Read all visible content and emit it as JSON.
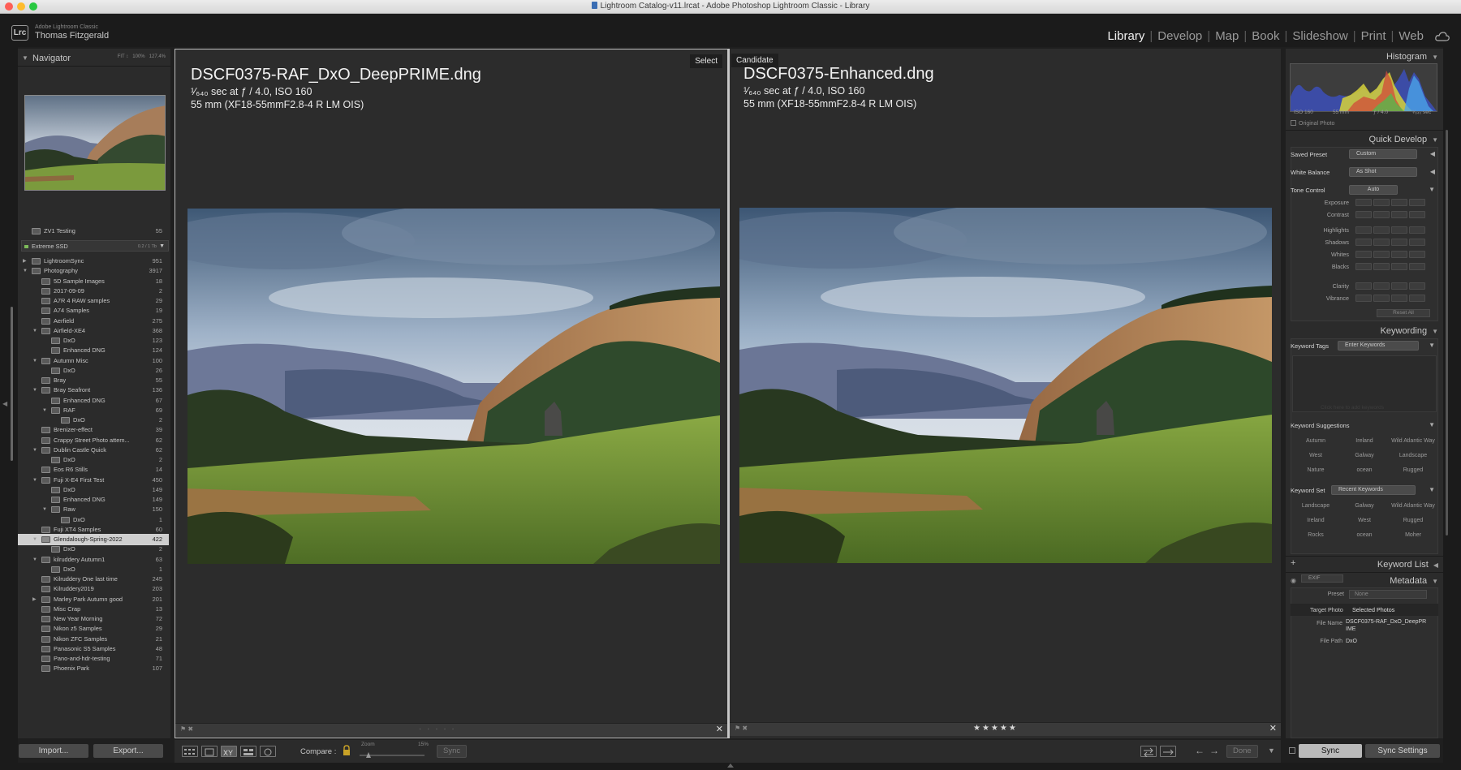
{
  "window": {
    "title": "Lightroom Catalog-v11.lrcat - Adobe Photoshop Lightroom Classic - Library"
  },
  "identity": {
    "logo": "Lrc",
    "app_name": "Adobe Lightroom Classic",
    "user_name": "Thomas Fitzgerald"
  },
  "modules": [
    "Library",
    "Develop",
    "Map",
    "Book",
    "Slideshow",
    "Print",
    "Web"
  ],
  "active_module": "Library",
  "navigator": {
    "title": "Navigator",
    "zooms": [
      "FIT ↕",
      "100%",
      "127.4%"
    ]
  },
  "folders": {
    "zvi": {
      "name": "ZV1 Testing",
      "count": "55"
    },
    "volume": {
      "name": "Extreme SSD",
      "size": "0.2 / 1 Tb"
    },
    "rows": [
      {
        "name": "LightroomSync",
        "count": "951",
        "depth": 0,
        "disc": "▶"
      },
      {
        "name": "Photography",
        "count": "3917",
        "depth": 0,
        "disc": "▼"
      },
      {
        "name": "5D Sample Images",
        "count": "18",
        "depth": 1,
        "disc": ""
      },
      {
        "name": "2017-09-09",
        "count": "2",
        "depth": 1,
        "disc": ""
      },
      {
        "name": "A7R 4 RAW samples",
        "count": "29",
        "depth": 1,
        "disc": ""
      },
      {
        "name": "A74 Samples",
        "count": "19",
        "depth": 1,
        "disc": ""
      },
      {
        "name": "Aerfield",
        "count": "275",
        "depth": 1,
        "disc": ""
      },
      {
        "name": "Airfield-XE4",
        "count": "368",
        "depth": 1,
        "disc": "▼"
      },
      {
        "name": "DxO",
        "count": "123",
        "depth": 2,
        "disc": ""
      },
      {
        "name": "Enhanced DNG",
        "count": "124",
        "depth": 2,
        "disc": ""
      },
      {
        "name": "Autumn Misc",
        "count": "100",
        "depth": 1,
        "disc": "▼"
      },
      {
        "name": "DxO",
        "count": "26",
        "depth": 2,
        "disc": ""
      },
      {
        "name": "Bray",
        "count": "55",
        "depth": 1,
        "disc": ""
      },
      {
        "name": "Bray Seafront",
        "count": "136",
        "depth": 1,
        "disc": "▼"
      },
      {
        "name": "Enhanced DNG",
        "count": "67",
        "depth": 2,
        "disc": ""
      },
      {
        "name": "RAF",
        "count": "69",
        "depth": 2,
        "disc": "▼"
      },
      {
        "name": "DxO",
        "count": "2",
        "depth": 3,
        "disc": ""
      },
      {
        "name": "Brenizer-effect",
        "count": "39",
        "depth": 1,
        "disc": ""
      },
      {
        "name": "Crappy Street Photo attem...",
        "count": "62",
        "depth": 1,
        "disc": ""
      },
      {
        "name": "Dublin Castle Quick",
        "count": "62",
        "depth": 1,
        "disc": "▼"
      },
      {
        "name": "DxO",
        "count": "2",
        "depth": 2,
        "disc": ""
      },
      {
        "name": "Eos R6 Stills",
        "count": "14",
        "depth": 1,
        "disc": ""
      },
      {
        "name": "Fuji X-E4 First Test",
        "count": "450",
        "depth": 1,
        "disc": "▼"
      },
      {
        "name": "DxO",
        "count": "149",
        "depth": 2,
        "disc": ""
      },
      {
        "name": "Enhanced DNG",
        "count": "149",
        "depth": 2,
        "disc": ""
      },
      {
        "name": "Raw",
        "count": "150",
        "depth": 2,
        "disc": "▼"
      },
      {
        "name": "DxO",
        "count": "1",
        "depth": 3,
        "disc": ""
      },
      {
        "name": "Fuji XT4 Samples",
        "count": "60",
        "depth": 1,
        "disc": ""
      },
      {
        "name": "Glendalough-Spring-2022",
        "count": "422",
        "depth": 1,
        "disc": "▼",
        "selected": true
      },
      {
        "name": "DxO",
        "count": "2",
        "depth": 2,
        "disc": ""
      },
      {
        "name": "kilruddery Autumn1",
        "count": "63",
        "depth": 1,
        "disc": "▼"
      },
      {
        "name": "DxO",
        "count": "1",
        "depth": 2,
        "disc": ""
      },
      {
        "name": "Kilruddery One last time",
        "count": "245",
        "depth": 1,
        "disc": ""
      },
      {
        "name": "Kilruddery2019",
        "count": "203",
        "depth": 1,
        "disc": ""
      },
      {
        "name": "Marley Park Autumn good",
        "count": "201",
        "depth": 1,
        "disc": "▶"
      },
      {
        "name": "Misc Crap",
        "count": "13",
        "depth": 1,
        "disc": ""
      },
      {
        "name": "New Year Morning",
        "count": "72",
        "depth": 1,
        "disc": ""
      },
      {
        "name": "Nikon z5 Samples",
        "count": "29",
        "depth": 1,
        "disc": ""
      },
      {
        "name": "Nikon ZFC Samples",
        "count": "21",
        "depth": 1,
        "disc": ""
      },
      {
        "name": "Panasonic S5 Samples",
        "count": "48",
        "depth": 1,
        "disc": ""
      },
      {
        "name": "Pano-and-hdr-testing",
        "count": "71",
        "depth": 1,
        "disc": ""
      },
      {
        "name": "Phoenix Park",
        "count": "107",
        "depth": 1,
        "disc": ""
      }
    ]
  },
  "left_buttons": {
    "import": "Import...",
    "export": "Export..."
  },
  "compare": {
    "select": {
      "tag": "Select",
      "filename": "DSCF0375-RAF_DxO_DeepPRIME.dng",
      "exif_shutter": "¹⁄₆₄₀ sec at ƒ / 4.0, ISO 160",
      "exif_lens": "55 mm (XF18-55mmF2.8-4 R LM OIS)",
      "stars": "· · · · ·"
    },
    "candidate": {
      "tag": "Candidate",
      "filename": "DSCF0375-Enhanced.dng",
      "exif_shutter": "¹⁄₆₄₀ sec at ƒ / 4.0, ISO 160",
      "exif_lens": "55 mm (XF18-55mmF2.8-4 R LM OIS)",
      "stars": "★★★★★"
    }
  },
  "toolbar": {
    "compare_label": "Compare :",
    "zoom_label": "Zoom",
    "zoom_value": "15%",
    "sync": "Sync",
    "done": "Done"
  },
  "right_panel": {
    "histogram": {
      "title": "Histogram",
      "iso": "ISO 160",
      "focal": "55 mm",
      "aperture": "ƒ / 4.0",
      "shutter": "¹⁄₆₄₀ sec",
      "original_photo": "Original Photo"
    },
    "quick_develop": {
      "title": "Quick Develop",
      "saved_preset_label": "Saved Preset",
      "saved_preset_value": "Custom",
      "wb_label": "White Balance",
      "wb_value": "As Shot",
      "tone_label": "Tone Control",
      "auto": "Auto",
      "rows": [
        "Exposure",
        "Contrast",
        "Highlights",
        "Shadows",
        "Whites",
        "Blacks",
        "Clarity",
        "Vibrance"
      ],
      "reset": "Reset All"
    },
    "keywording": {
      "title": "Keywording",
      "tags_label": "Keyword Tags",
      "tags_value": "Enter Keywords",
      "placeholder": "Click here to add keywords",
      "suggestions_label": "Keyword Suggestions",
      "suggestions": [
        "Autumn",
        "Ireland",
        "Wild Atlantic Way",
        "West",
        "Galway",
        "Landscape",
        "Nature",
        "ocean",
        "Rugged"
      ],
      "set_label": "Keyword Set",
      "set_value": "Recent Keywords",
      "set": [
        "Landscape",
        "Galway",
        "Wild Atlantic Way",
        "Ireland",
        "West",
        "Rugged",
        "Rocks",
        "ocean",
        "Moher"
      ]
    },
    "keyword_list": {
      "title": "Keyword List"
    },
    "metadata": {
      "title": "Metadata",
      "view": "EXIF",
      "preset_label": "Preset",
      "preset_value": "None",
      "target_label": "Target Photo",
      "target_value": "Selected Photos",
      "filename_label": "File Name",
      "filename_value": "DSCF0375-RAF_DxO_DeepPRIME",
      "filepath_label": "File Path",
      "filepath_value": "DxO"
    }
  },
  "right_buttons": {
    "sync": "Sync",
    "sync_settings": "Sync Settings"
  }
}
